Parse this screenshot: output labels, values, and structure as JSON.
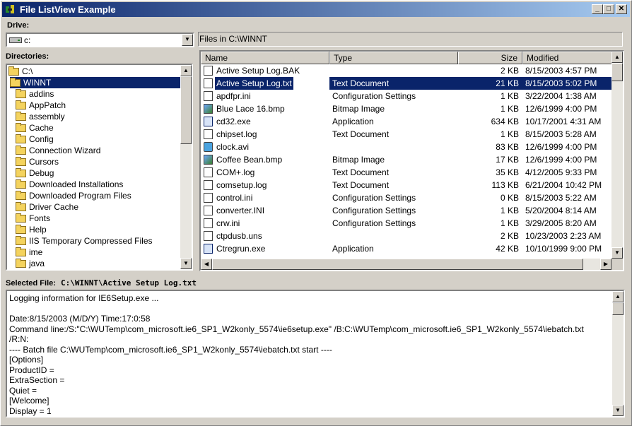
{
  "window": {
    "title": "File ListView Example"
  },
  "drive": {
    "label": "Drive:",
    "value": "c:"
  },
  "path_label": "Files in C:\\WINNT",
  "directories": {
    "label": "Directories:",
    "items": [
      {
        "name": "C:\\",
        "depth": 0,
        "selected": false,
        "open": true
      },
      {
        "name": "WINNT",
        "depth": 1,
        "selected": true,
        "open": true
      },
      {
        "name": "addins",
        "depth": 2,
        "selected": false
      },
      {
        "name": "AppPatch",
        "depth": 2,
        "selected": false
      },
      {
        "name": "assembly",
        "depth": 2,
        "selected": false
      },
      {
        "name": "Cache",
        "depth": 2,
        "selected": false
      },
      {
        "name": "Config",
        "depth": 2,
        "selected": false
      },
      {
        "name": "Connection Wizard",
        "depth": 2,
        "selected": false
      },
      {
        "name": "Cursors",
        "depth": 2,
        "selected": false
      },
      {
        "name": "Debug",
        "depth": 2,
        "selected": false
      },
      {
        "name": "Downloaded Installations",
        "depth": 2,
        "selected": false
      },
      {
        "name": "Downloaded Program Files",
        "depth": 2,
        "selected": false
      },
      {
        "name": "Driver Cache",
        "depth": 2,
        "selected": false
      },
      {
        "name": "Fonts",
        "depth": 2,
        "selected": false
      },
      {
        "name": "Help",
        "depth": 2,
        "selected": false
      },
      {
        "name": "IIS Temporary Compressed Files",
        "depth": 2,
        "selected": false
      },
      {
        "name": "ime",
        "depth": 2,
        "selected": false
      },
      {
        "name": "java",
        "depth": 2,
        "selected": false
      }
    ]
  },
  "files": {
    "columns": [
      "Name",
      "Type",
      "Size",
      "Modified"
    ],
    "rows": [
      {
        "name": "Active Setup Log.BAK",
        "type": "",
        "size": "2 KB",
        "modified": "8/15/2003 4:57 PM",
        "icon": "bak-file-icon",
        "selected": false
      },
      {
        "name": "Active Setup Log.txt",
        "type": "Text Document",
        "size": "21 KB",
        "modified": "8/15/2003 5:02 PM",
        "icon": "text-file-icon",
        "selected": true
      },
      {
        "name": "apdfpr.ini",
        "type": "Configuration Settings",
        "size": "1 KB",
        "modified": "3/22/2004 1:38 AM",
        "icon": "ini-file-icon",
        "selected": false
      },
      {
        "name": "Blue Lace 16.bmp",
        "type": "Bitmap Image",
        "size": "1 KB",
        "modified": "12/6/1999 4:00 PM",
        "icon": "bitmap-file-icon",
        "selected": false
      },
      {
        "name": "cd32.exe",
        "type": "Application",
        "size": "634 KB",
        "modified": "10/17/2001 4:31 AM",
        "icon": "exe-file-icon",
        "selected": false
      },
      {
        "name": "chipset.log",
        "type": "Text Document",
        "size": "1 KB",
        "modified": "8/15/2003 5:28 AM",
        "icon": "text-file-icon",
        "selected": false
      },
      {
        "name": "clock.avi",
        "type": "",
        "size": "83 KB",
        "modified": "12/6/1999 4:00 PM",
        "icon": "video-file-icon",
        "selected": false
      },
      {
        "name": "Coffee Bean.bmp",
        "type": "Bitmap Image",
        "size": "17 KB",
        "modified": "12/6/1999 4:00 PM",
        "icon": "bitmap-file-icon",
        "selected": false
      },
      {
        "name": "COM+.log",
        "type": "Text Document",
        "size": "35 KB",
        "modified": "4/12/2005 9:33 PM",
        "icon": "text-file-icon",
        "selected": false
      },
      {
        "name": "comsetup.log",
        "type": "Text Document",
        "size": "113 KB",
        "modified": "6/21/2004 10:42 PM",
        "icon": "text-file-icon",
        "selected": false
      },
      {
        "name": "control.ini",
        "type": "Configuration Settings",
        "size": "0 KB",
        "modified": "8/15/2003 5:22 AM",
        "icon": "ini-file-icon",
        "selected": false
      },
      {
        "name": "converter.INI",
        "type": "Configuration Settings",
        "size": "1 KB",
        "modified": "5/20/2004 8:14 AM",
        "icon": "ini-file-icon",
        "selected": false
      },
      {
        "name": "crw.ini",
        "type": "Configuration Settings",
        "size": "1 KB",
        "modified": "3/29/2005 8:20 AM",
        "icon": "ini-file-icon",
        "selected": false
      },
      {
        "name": "ctpdusb.uns",
        "type": "",
        "size": "2 KB",
        "modified": "10/23/2003 2:23 AM",
        "icon": "generic-file-icon",
        "selected": false
      },
      {
        "name": "Ctregrun.exe",
        "type": "Application",
        "size": "42 KB",
        "modified": "10/10/1999 9:00 PM",
        "icon": "exe-file-icon",
        "selected": false
      }
    ]
  },
  "selected_file": {
    "label": "Selected File:",
    "path": "C:\\WINNT\\Active Setup Log.txt"
  },
  "log_text": "Logging information for IE6Setup.exe ...\n\nDate:8/15/2003 (M/D/Y) Time:17:0:58\nCommand line:/S:\"C:\\WUTemp\\com_microsoft.ie6_SP1_W2konly_5574\\ie6setup.exe\" /B:C:\\WUTemp\\com_microsoft.ie6_SP1_W2konly_5574\\iebatch.txt\n/R:N:\n---- Batch file C:\\WUTemp\\com_microsoft.ie6_SP1_W2konly_5574\\iebatch.txt start ----\n[Options]\nProductID =\nExtraSection =\nQuiet =\n[Welcome]\nDisplay = 1",
  "colors": {
    "title_start": "#0a246a",
    "title_end": "#a6caf0",
    "selection": "#0a246a",
    "face": "#d4d0c8"
  }
}
